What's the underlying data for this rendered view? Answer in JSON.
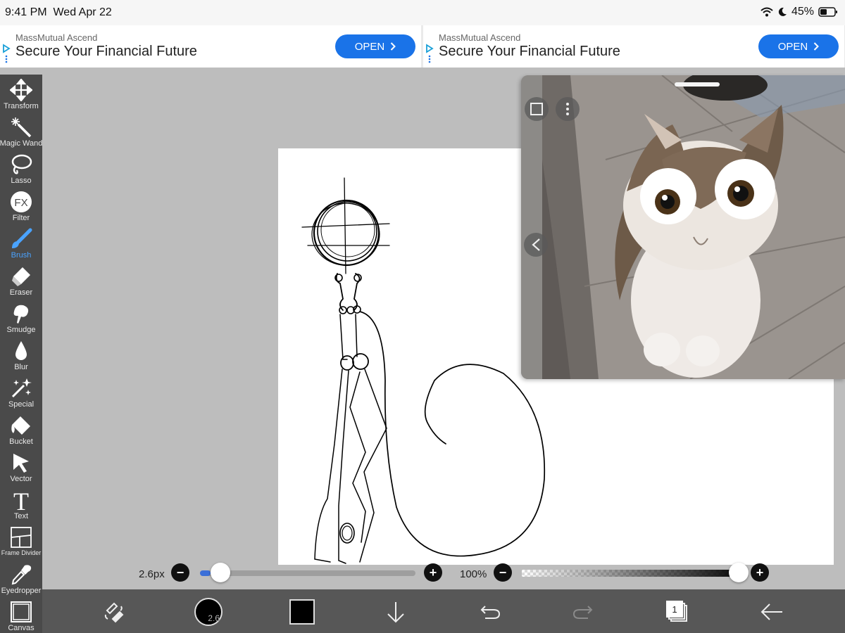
{
  "status": {
    "time": "9:41 PM",
    "date": "Wed Apr 22",
    "battery": "45%"
  },
  "ads": [
    {
      "brand": "MassMutual Ascend",
      "title": "Secure Your Financial Future",
      "button": "OPEN"
    },
    {
      "brand": "MassMutual Ascend",
      "title": "Secure Your Financial Future",
      "button": "OPEN"
    }
  ],
  "tools": [
    {
      "label": "Transform",
      "icon": "move-arrows-icon"
    },
    {
      "label": "Magic Wand",
      "icon": "magic-wand-icon"
    },
    {
      "label": "Lasso",
      "icon": "lasso-icon"
    },
    {
      "label": "Filter",
      "icon": "fx-icon",
      "glyph": "FX"
    },
    {
      "label": "Brush",
      "icon": "brush-icon",
      "active": true
    },
    {
      "label": "Eraser",
      "icon": "eraser-icon"
    },
    {
      "label": "Smudge",
      "icon": "smudge-icon"
    },
    {
      "label": "Blur",
      "icon": "droplet-icon"
    },
    {
      "label": "Special",
      "icon": "sparkle-icon"
    },
    {
      "label": "Bucket",
      "icon": "bucket-icon"
    },
    {
      "label": "Vector",
      "icon": "cursor-arrow-icon"
    },
    {
      "label": "Text",
      "icon": "text-icon",
      "glyph": "T"
    },
    {
      "label": "Frame Divider",
      "icon": "frame-divider-icon"
    },
    {
      "label": "Eyedropper",
      "icon": "eyedropper-icon"
    },
    {
      "label": "Canvas",
      "icon": "canvas-icon"
    }
  ],
  "brush": {
    "size_label": "2.6px",
    "size_badge": "2.6",
    "size_level": 0.05
  },
  "opacity": {
    "label": "100%",
    "level": 1.0
  },
  "color": {
    "current": "#000000",
    "accent": "#4aa3ff",
    "ad_button": "#1a73e8"
  },
  "layers": {
    "count": "1"
  }
}
